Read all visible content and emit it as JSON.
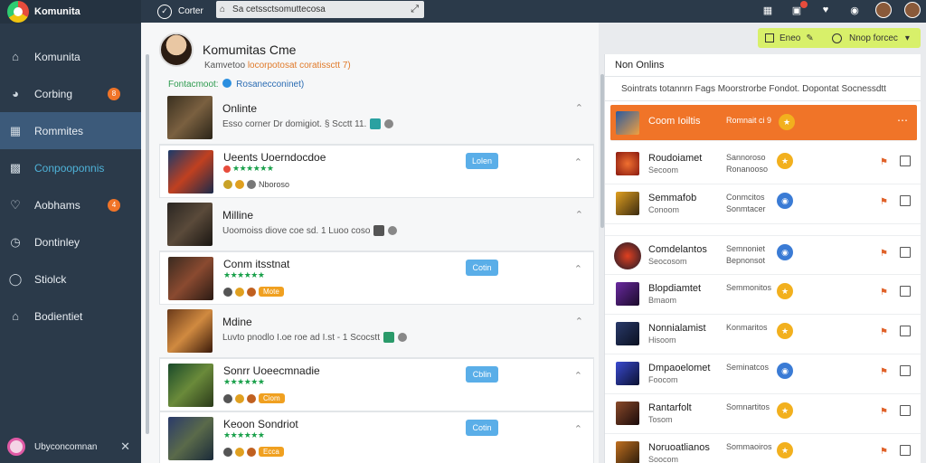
{
  "brand": {
    "name": "Komunita"
  },
  "sidebar": {
    "items": [
      {
        "label": "Komunita",
        "icon": "home-icon"
      },
      {
        "label": "Corbing",
        "icon": "gauge-icon",
        "badge": "8"
      },
      {
        "label": "Rommites",
        "icon": "calendar-icon"
      },
      {
        "label": "Conpooponnis",
        "icon": "chart-icon"
      },
      {
        "label": "Aobhams",
        "icon": "heart-icon",
        "badge": "4"
      },
      {
        "label": "Dontinley",
        "icon": "clock-icon"
      },
      {
        "label": "Stiolck",
        "icon": "shield-icon"
      },
      {
        "label": "Bodientiet",
        "icon": "home-icon"
      }
    ],
    "user_label": "Ubyconcomnan"
  },
  "topbar": {
    "title": "Corter",
    "search_value": "Sa cetssctsomuttecosa"
  },
  "header": {
    "title": "Komumitas Cme",
    "subtitle_prefix": "Kamvetoo",
    "subtitle_highlight": "locorpotosat coratissctt 7)",
    "filter_label": "Fontacmoot:",
    "filter_value": "Rosanecconinet)"
  },
  "actions": {
    "first_label": "Eneo",
    "second_label": "Nnop forcec"
  },
  "games": [
    {
      "title": "Onlinte",
      "meta": "Esso corner Dr domigiot. § Scctt 11.",
      "join": ""
    },
    {
      "title": "Ueents Uoerndocdoe",
      "stars": "★★★★★★",
      "meta": "Nboroso",
      "join": "Lolen"
    },
    {
      "title": "Milline",
      "meta": "Uoomoiss diove coe sd. 1 Luoo coso",
      "join": ""
    },
    {
      "title": "Conm itsstnat",
      "stars": "★★★★★★",
      "meta": "Mote",
      "join": "Cotin"
    },
    {
      "title": "Mdine",
      "meta": "Luvto pnodlo I.oe roe ad I.st - 1 Scocstt",
      "join": ""
    },
    {
      "title": "Sonrr Uoeecmnadie",
      "stars": "★★★★★★",
      "meta": "Ciom",
      "join": "Cblin"
    },
    {
      "title": "Keoon Sondriot",
      "stars": "★★★★★★",
      "meta": "Ecca",
      "join": "Cotin"
    }
  ],
  "right": {
    "title": "Non Onlins",
    "columns": "Sointrats totannrn Fags Moorstrorbe Fondot. Dopontat Socnessdtt",
    "rows": [
      {
        "name": "Coom Ioiltis",
        "mid": "Romnait ci 9"
      },
      {
        "name": "Roudoiamet",
        "sub": "Secoom",
        "mid": "Sannoroso",
        "mid2": "Ronanooso"
      },
      {
        "name": "Semmafob",
        "sub": "Conoom",
        "mid": "Conmcitos",
        "mid2": "Sonmtacer"
      },
      {
        "name": "Comdelantos",
        "sub": "Seocosom",
        "mid": "Semnoniet",
        "mid2": "Bepnonsot"
      },
      {
        "name": "Blopdiamtet",
        "sub": "Bmaom",
        "mid": "Semmonitos"
      },
      {
        "name": "Nonnialamist",
        "sub": "Hisoom",
        "mid": "Konmaritos"
      },
      {
        "name": "Dmpaoelomet",
        "sub": "Foocom",
        "mid": "Seminatcos"
      },
      {
        "name": "Rantarfolt",
        "sub": "Tosom",
        "mid": "Somnartitos"
      },
      {
        "name": "Noruoatlianos",
        "sub": "Soocom",
        "mid": "Sommaoiros"
      }
    ]
  }
}
